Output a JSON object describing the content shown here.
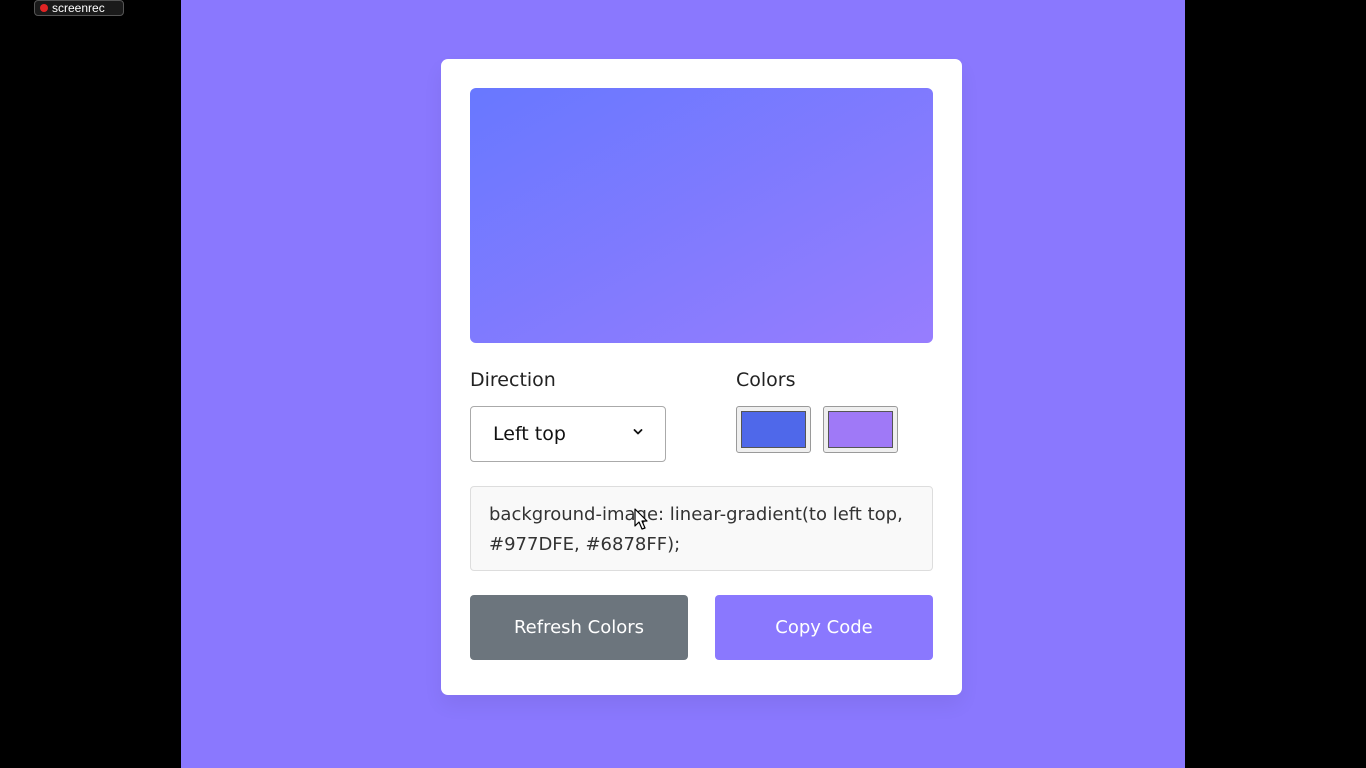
{
  "recorder": {
    "label": "screenrec",
    "dot_color": "#e02424"
  },
  "page": {
    "background": "#8a78fe"
  },
  "preview": {
    "direction": "to left top",
    "color_start": "#977DFE",
    "color_end": "#6878FF"
  },
  "direction": {
    "label": "Direction",
    "selected": "Left top",
    "icon": "chevron-down-icon"
  },
  "colors": {
    "label": "Colors",
    "swatch_1": "#4f68ea",
    "swatch_2": "#9f79f7"
  },
  "code": {
    "text": "background-image: linear-gradient(to left top, #977DFE,  #6878FF);"
  },
  "buttons": {
    "refresh_label": "Refresh Colors",
    "refresh_color": "#6c757d",
    "copy_label": "Copy Code",
    "copy_color": "#8a78fe"
  }
}
